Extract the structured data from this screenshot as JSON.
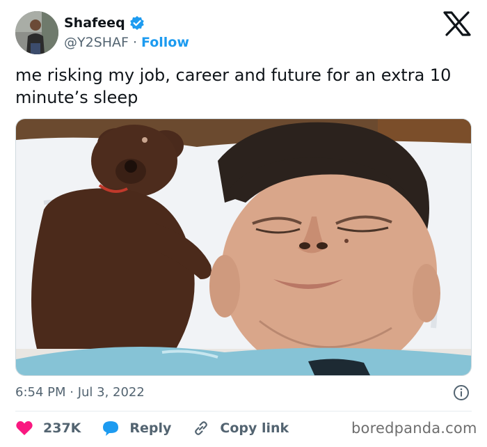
{
  "author": {
    "name": "Shafeeq",
    "handle": "@Y2SHAF",
    "separator": "·",
    "follow_label": "Follow",
    "verified": true
  },
  "tweet": {
    "text": "me risking my job, career and future for an extra 10 minute’s sleep",
    "timestamp": "6:54 PM · Jul 3, 2022"
  },
  "actions": {
    "like_count": "237K",
    "reply_label": "Reply",
    "copy_link_label": "Copy link"
  },
  "watermark": "boredpanda.com",
  "icons": {
    "verified": "verified-badge-icon",
    "x": "x-logo-icon",
    "info": "info-icon",
    "like": "heart-icon",
    "reply": "speech-bubble-icon",
    "copy": "link-icon"
  },
  "colors": {
    "accent": "#1d9bf0",
    "like": "#f91880",
    "text": "#0f1419",
    "muted": "#536471"
  }
}
